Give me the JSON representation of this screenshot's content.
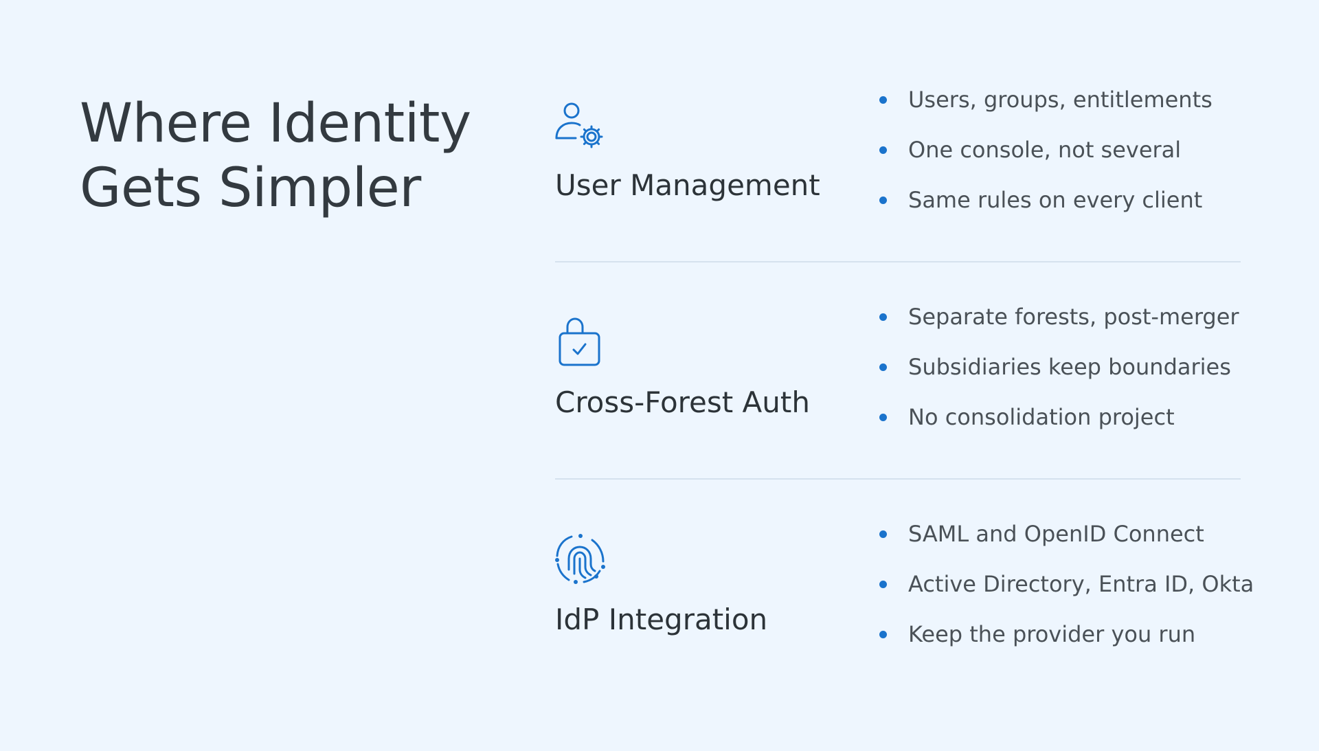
{
  "title": {
    "line1": "Where Identity",
    "line2": "Gets Simpler"
  },
  "colors": {
    "background": "#eef6fe",
    "accent": "#1a73cc",
    "text": "#333a40",
    "divider": "#d5e2ee"
  },
  "sections": [
    {
      "icon": "user-gear-icon",
      "heading": "User Management",
      "bullets": [
        "Users, groups, entitlements",
        "One console, not several",
        "Same rules on every client"
      ]
    },
    {
      "icon": "lock-check-icon",
      "heading": "Cross-Forest Auth",
      "bullets": [
        "Separate forests, post-merger",
        "Subsidiaries keep boundaries",
        "No consolidation project"
      ]
    },
    {
      "icon": "fingerprint-icon",
      "heading": "IdP Integration",
      "bullets": [
        "SAML and OpenID Connect",
        "Active Directory, Entra ID, Okta",
        "Keep the provider you run"
      ]
    }
  ]
}
